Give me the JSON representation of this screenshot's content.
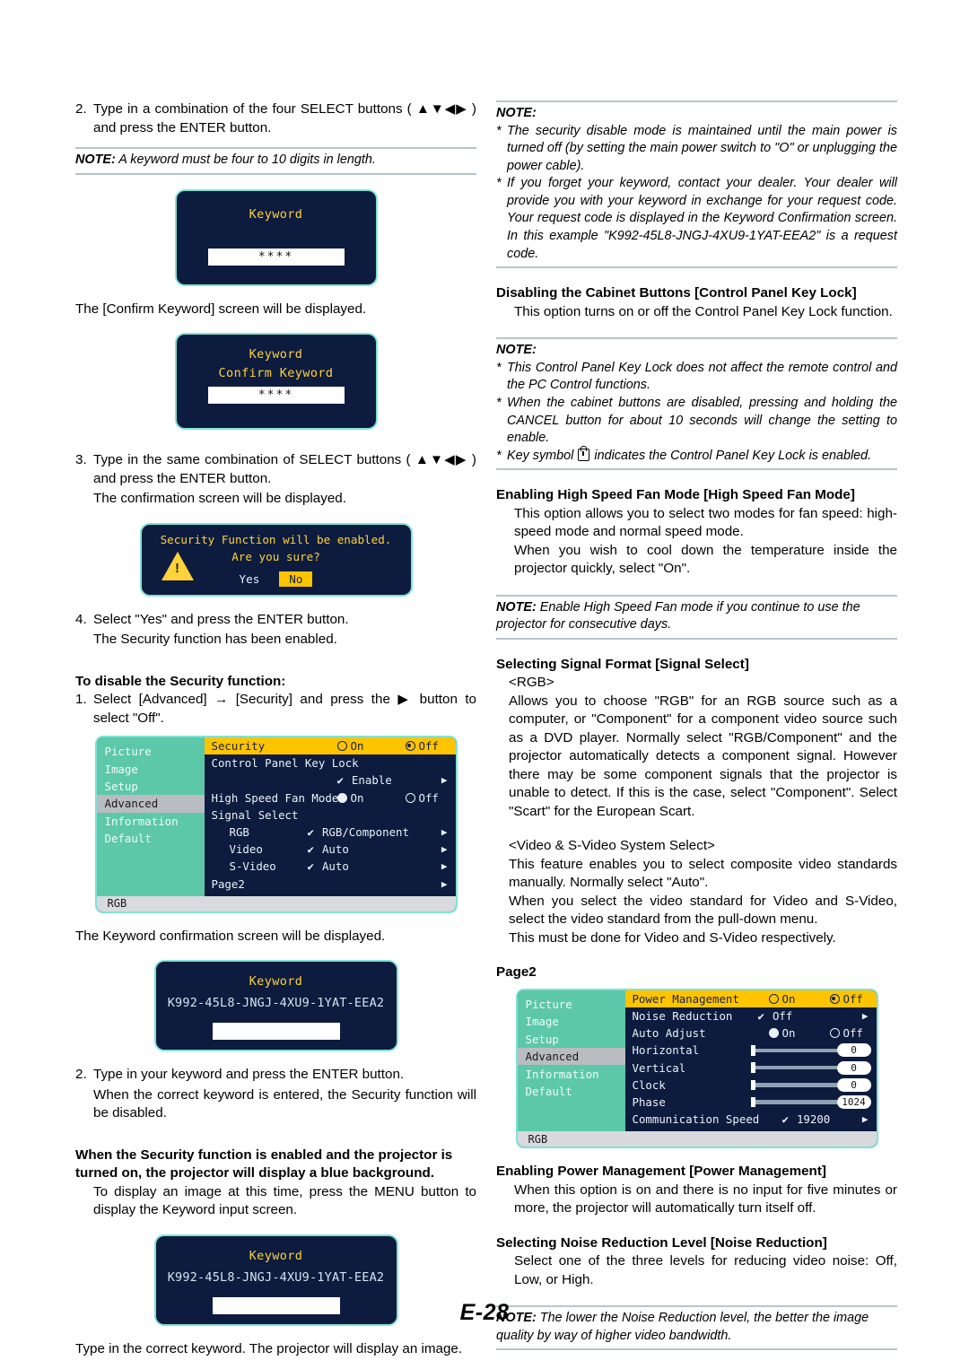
{
  "page": {
    "number": "E-28"
  },
  "left": {
    "step2": {
      "num": "2.",
      "text": "Type in a combination of the four SELECT buttons ( ▲▼◀▶ ) and press the ENTER button."
    },
    "note_keyword_length": {
      "label": "NOTE:",
      "text": " A keyword must be four to 10 digits in length."
    },
    "dialog_keyword": {
      "title": "Keyword",
      "field_value": "****"
    },
    "confirm_keyword_caption": "The [Confirm Keyword] screen will be displayed.",
    "dialog_keyword_confirm": {
      "title": "Keyword",
      "subtitle": "Confirm Keyword",
      "field_value": "****"
    },
    "step3": {
      "num": "3.",
      "text": "Type in the same combination of SELECT buttons ( ▲▼◀▶ ) and press the ENTER button.",
      "text2": "The confirmation screen will be displayed."
    },
    "dialog_security_confirm": {
      "line1": "Security Function will be enabled.",
      "line2": "Are you sure?",
      "yes": "Yes",
      "no": "No"
    },
    "step4": {
      "num": "4.",
      "text": "Select \"Yes\" and press the ENTER button.",
      "text2": "The Security function has been enabled."
    },
    "disable_heading": "To disable the Security function:",
    "disable_step1": {
      "num": "1.",
      "text": "Select [Advanced] → [Security] and press the ▶ button to select \"Off\"."
    },
    "osd_security": {
      "sidebar": [
        "Picture",
        "Image",
        "Setup",
        "Advanced",
        "Information",
        "Default"
      ],
      "sidebar_selected": "Advanced",
      "rows": [
        {
          "label": "Security",
          "on": "On",
          "off": "Off",
          "selected": "Off"
        },
        {
          "label": "Control Panel Key Lock"
        },
        {
          "label": "",
          "check": "Enable"
        },
        {
          "label": "High Speed Fan Mode",
          "on": "On",
          "off": "Off",
          "selected": "On"
        },
        {
          "label": "Signal Select"
        },
        {
          "label": "RGB",
          "check": "RGB/Component"
        },
        {
          "label": "Video",
          "check": "Auto"
        },
        {
          "label": "S-Video",
          "check": "Auto"
        },
        {
          "label": "Page2"
        }
      ],
      "footer": "RGB"
    },
    "keyword_confirmation_caption": "The Keyword confirmation screen will be displayed.",
    "dialog_keyword_code": {
      "title": "Keyword",
      "code": "K992-45L8-JNGJ-4XU9-1YAT-EEA2",
      "field_value": ""
    },
    "step2b": {
      "num": "2.",
      "text": "Type in your keyword and press the ENTER button.",
      "text2": "When the correct keyword is entered, the Security function will be disabled."
    },
    "blue_background_heading": "When the Security function is enabled and the projector is turned on, the projector will display a blue background.",
    "blue_background_body": "To display an image at this time, press the MENU button to display the Keyword input screen.",
    "dialog_keyword_code2": {
      "title": "Keyword",
      "code": "K992-45L8-JNGJ-4XU9-1YAT-EEA2",
      "field_value": ""
    },
    "final_caption": "Type in the correct keyword. The projector will display an image."
  },
  "right": {
    "note_top": {
      "label": "NOTE:",
      "items": [
        "The security disable mode is maintained until the main power is turned off (by setting the main power switch to \"O\" or unplugging the power cable).",
        "If you forget your keyword, contact your dealer. Your dealer will provide you with your keyword in exchange for your request code. Your request code is displayed in the Keyword Confirmation screen. In this example \"K992-45L8-JNGJ-4XU9-1YAT-EEA2\" is a request code."
      ]
    },
    "cabinet_heading": "Disabling the Cabinet Buttons [Control Panel Key Lock]",
    "cabinet_body": "This option turns on or off the Control Panel Key Lock function.",
    "note_keylock": {
      "label": "NOTE:",
      "items": [
        "This Control Panel Key Lock does not affect the remote control and the PC Control functions.",
        "When the cabinet buttons are disabled, pressing and holding the CANCEL button for about 10 seconds will change the setting to enable."
      ],
      "item_key_pre": "Key symbol ",
      "item_key_post": " indicates the Control Panel Key Lock is enabled."
    },
    "fan_heading": "Enabling High Speed Fan Mode [High Speed Fan Mode]",
    "fan_body1": "This option allows you to select two modes for fan speed: high-speed mode and normal speed mode.",
    "fan_body2": "When you wish to cool down the temperature inside the projector quickly, select \"On\".",
    "note_fan": {
      "label": "NOTE:",
      "text": " Enable High Speed Fan mode if you continue to use the projector for consecutive days."
    },
    "signal_heading": "Selecting Signal Format [Signal Select]",
    "signal_rgb_title": "<RGB>",
    "signal_rgb_body": "Allows you to choose \"RGB\" for an RGB source such as a computer, or \"Component\" for a component video source such as a DVD player. Normally select \"RGB/Component\" and the projector automatically detects a component signal. However there may be some component signals that the projector is unable to detect. If this is the case, select \"Component\". Select \"Scart\" for the European Scart.",
    "signal_video_title": "<Video & S-Video System Select>",
    "signal_video_body1": "This feature enables you to select composite video standards manually. Normally select \"Auto\".",
    "signal_video_body2": "When you select the video standard for Video and S-Video, select the video standard from the pull-down menu.",
    "signal_video_body3": "This must be done for Video and S-Video respectively.",
    "page2_heading": "Page2",
    "osd_page2": {
      "sidebar": [
        "Picture",
        "Image",
        "Setup",
        "Advanced",
        "Information",
        "Default"
      ],
      "sidebar_selected": "Advanced",
      "rows": [
        {
          "label": "Power Management",
          "on": "On",
          "off": "Off",
          "selected": "Off"
        },
        {
          "label": "Noise Reduction",
          "check": "Off"
        },
        {
          "label": "Auto Adjust",
          "on": "On",
          "off": "Off",
          "selected": "On"
        },
        {
          "label": "Horizontal",
          "value": "0"
        },
        {
          "label": "Vertical",
          "value": "0"
        },
        {
          "label": "Clock",
          "value": "0"
        },
        {
          "label": "Phase",
          "value": "1024"
        },
        {
          "label": "Communication Speed",
          "check": "19200"
        }
      ],
      "footer": "RGB"
    },
    "power_heading": "Enabling Power Management [Power Management]",
    "power_body": "When this option is on and there is no input for five minutes or more, the projector will automatically turn itself off.",
    "noise_heading": "Selecting Noise Reduction Level [Noise Reduction]",
    "noise_body": "Select one of the three levels for reducing video noise: Off, Low, or High.",
    "note_noise": {
      "label": "NOTE:",
      "text": " The lower the Noise Reduction level, the better the image quality by way of higher video bandwidth."
    }
  },
  "colors": {
    "osd_background": "#0d1b3e",
    "osd_highlight": "#ffc400",
    "osd_sidebar": "#5cc8a8",
    "osd_border": "#7fe3d4",
    "dialog_title": "#ffd23a",
    "note_rule": "#b9c4c9"
  }
}
